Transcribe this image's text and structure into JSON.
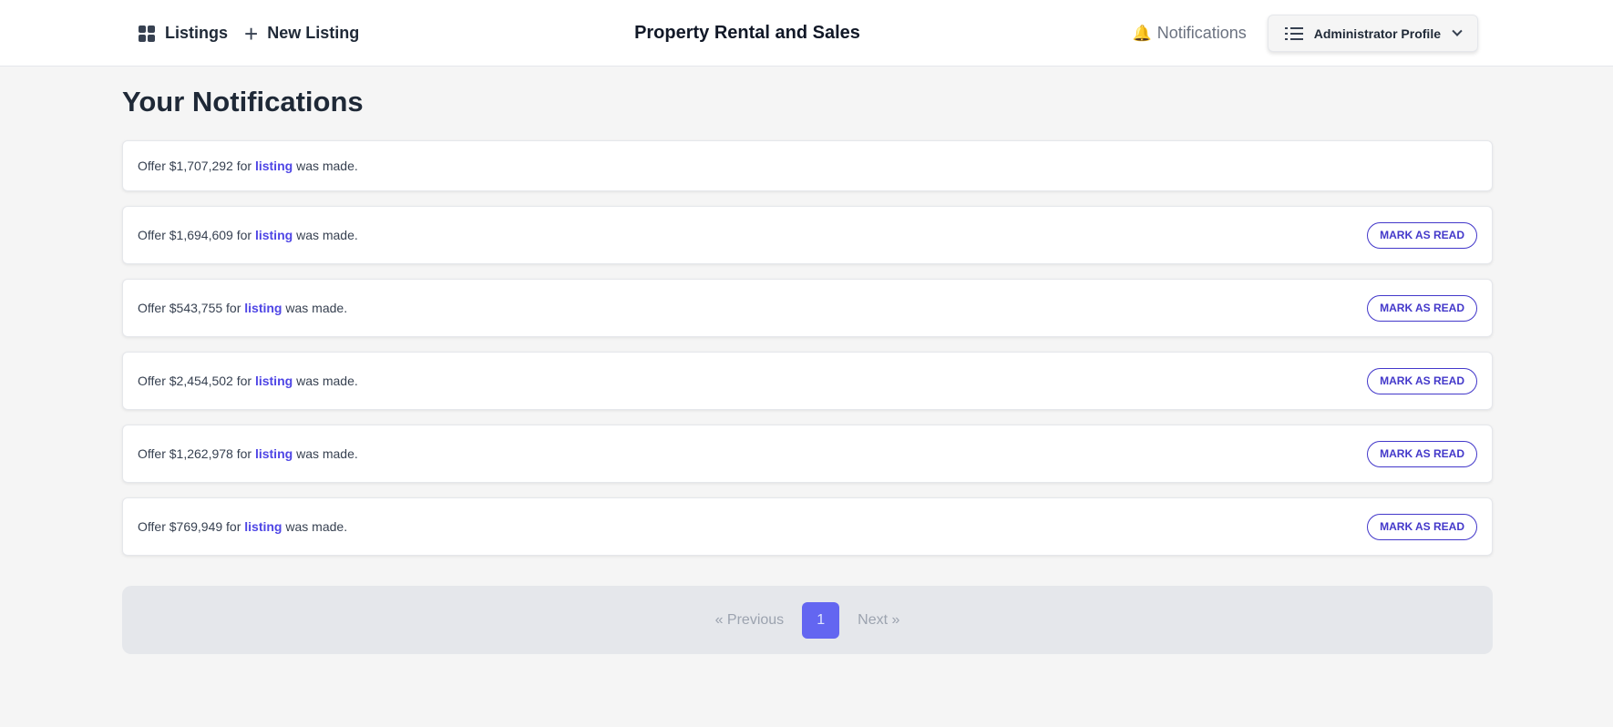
{
  "nav": {
    "listings_label": "Listings",
    "new_listing_label": "New Listing",
    "title": "Property Rental and Sales",
    "notifications_label": "Notifications",
    "profile_label": "Administrator Profile"
  },
  "page": {
    "heading": "Your Notifications"
  },
  "notifications": [
    {
      "prefix": "Offer $1,707,292 for ",
      "link": "listing",
      "suffix": " was made.",
      "action": ""
    },
    {
      "prefix": "Offer $1,694,609 for ",
      "link": "listing",
      "suffix": " was made.",
      "action": "MARK AS READ"
    },
    {
      "prefix": "Offer $543,755 for ",
      "link": "listing",
      "suffix": " was made.",
      "action": "MARK AS READ"
    },
    {
      "prefix": "Offer $2,454,502 for ",
      "link": "listing",
      "suffix": " was made.",
      "action": "MARK AS READ"
    },
    {
      "prefix": "Offer $1,262,978 for ",
      "link": "listing",
      "suffix": " was made.",
      "action": "MARK AS READ"
    },
    {
      "prefix": "Offer $769,949 for ",
      "link": "listing",
      "suffix": " was made.",
      "action": "MARK AS READ"
    }
  ],
  "pagination": {
    "previous_label": "« Previous",
    "current_page": "1",
    "next_label": "Next »"
  },
  "colors": {
    "accent": "#4f46e5",
    "page_active": "#6366f1",
    "background": "#f5f5f5"
  },
  "icons": {
    "listings": "grid-icon",
    "new_listing": "plus-icon",
    "notifications": "bell-icon",
    "profile": "list-icon",
    "profile_dropdown": "chevron-down-icon"
  }
}
